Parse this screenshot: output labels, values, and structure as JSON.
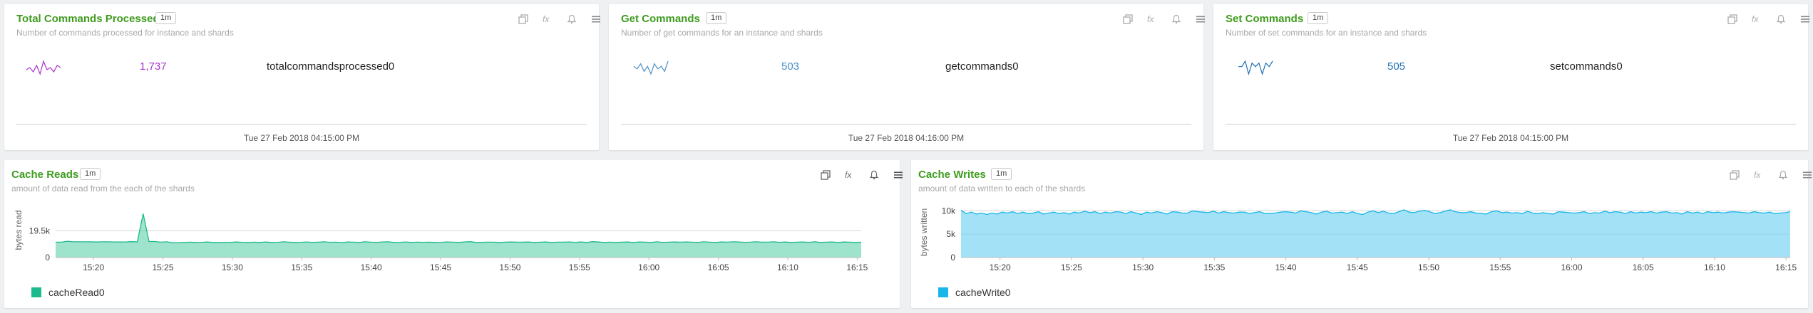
{
  "stats": [
    {
      "title": "Total Commands Processed",
      "interval": "1m",
      "subtitle": "Number of commands processed for instance and shards",
      "value": "1,737",
      "label": "totalcommandsprocessed0",
      "timestamp": "Tue 27 Feb 2018 04:15:00 PM",
      "color": "#a633cc",
      "spark": [
        5,
        6,
        4,
        7,
        3,
        9,
        5,
        6,
        4,
        7,
        6
      ]
    },
    {
      "title": "Get Commands",
      "interval": "1m",
      "subtitle": "Number of get commands for an instance and shards",
      "value": "503",
      "label": "getcommands0",
      "timestamp": "Tue 27 Feb 2018 04:16:00 PM",
      "color": "#4a8fc4",
      "spark": [
        6,
        5,
        7,
        4,
        6,
        3,
        7,
        5,
        6,
        4,
        8
      ]
    },
    {
      "title": "Set Commands",
      "interval": "1m",
      "subtitle": "Number of set commands for an instance and shards",
      "value": "505",
      "label": "setcommands0",
      "timestamp": "Tue 27 Feb 2018 04:15:00 PM",
      "color": "#1f6fb5",
      "spark": [
        6,
        6,
        9,
        2,
        8,
        6,
        8,
        2,
        8,
        6,
        9
      ]
    }
  ],
  "charts": [
    {
      "title": "Cache Reads",
      "interval": "1m",
      "subtitle": "amount of data read from the each of the shards",
      "legend": "cacheRead0",
      "color": "#1dba8e",
      "fill": "#9ee3cc",
      "chart_data": {
        "type": "area",
        "ylabel": "bytes read",
        "yticks": [
          0,
          19500
        ],
        "ytick_labels": [
          "0",
          "19.5k"
        ],
        "ylim": [
          0,
          40000
        ],
        "xticks": [
          "15:20",
          "15:25",
          "15:30",
          "15:35",
          "15:40",
          "15:45",
          "15:50",
          "15:55",
          "16:00",
          "16:05",
          "16:10",
          "16:15"
        ],
        "series": [
          {
            "name": "cacheRead0",
            "values": [
              11200,
              11200,
              11900,
              11500,
              11500,
              11500,
              11500,
              11300,
              11500,
              11500,
              11400,
              11300,
              11400,
              11600,
              11500,
              32000,
              11700,
              11700,
              11200,
              11500,
              10800,
              10800,
              11000,
              11200,
              11000,
              11100,
              11300,
              11000,
              11000,
              11000,
              11100,
              11300,
              11100,
              11000,
              11200,
              11000,
              11300,
              11000,
              11100,
              11500,
              11200,
              11000,
              11100,
              11400,
              11000,
              11200,
              11500,
              11100,
              11200,
              10900,
              11400,
              11200,
              11000,
              11500,
              11200,
              11100,
              11400,
              11500,
              11000,
              11100,
              11400,
              11000,
              11200,
              11100,
              11200,
              11000,
              11100,
              11400,
              11200,
              11000,
              11400,
              11600,
              11000,
              11100,
              11200,
              11200,
              11000,
              11200,
              11300,
              11200,
              11200,
              11300,
              11000,
              11200,
              11300,
              11000,
              11200,
              11200,
              11400,
              11100,
              11300,
              11000,
              11600,
              11300,
              11000,
              11200,
              11000,
              11200,
              11300,
              11000,
              11300,
              11200,
              11000,
              11500,
              11000,
              11200,
              11300,
              11200,
              11400,
              11200,
              11000,
              11500,
              11200,
              11000,
              11300,
              11200,
              11500,
              11300,
              11100,
              11200,
              11500,
              11200,
              11200,
              11500,
              11100,
              11300,
              11000,
              11200,
              11300,
              11100,
              11500,
              11000,
              11200,
              11300,
              11000,
              11300,
              11200,
              11000,
              11200
            ]
          }
        ]
      }
    },
    {
      "title": "Cache Writes",
      "interval": "1m",
      "subtitle": "amount of data written to each of the shards",
      "legend": "cacheWrite0",
      "color": "#19b6ea",
      "fill": "#a3e1f7",
      "chart_data": {
        "type": "area",
        "ylabel": "bytes written",
        "yticks": [
          0,
          5000,
          10000
        ],
        "ytick_labels": [
          "0",
          "5k",
          "10k"
        ],
        "ylim": [
          0,
          10800
        ],
        "xticks": [
          "15:20",
          "15:25",
          "15:30",
          "15:35",
          "15:40",
          "15:45",
          "15:50",
          "15:55",
          "16:00",
          "16:05",
          "16:10",
          "16:15"
        ],
        "series": [
          {
            "name": "cacheWrite0",
            "values": [
              10100,
              9400,
              9700,
              9300,
              9500,
              9200,
              9500,
              9300,
              9700,
              9500,
              9800,
              9400,
              9700,
              9400,
              9500,
              9800,
              9300,
              9500,
              9700,
              9400,
              9600,
              9300,
              9700,
              9500,
              9900,
              9600,
              9800,
              9400,
              9700,
              9500,
              9800,
              9700,
              9400,
              9800,
              9500,
              9200,
              9700,
              9500,
              9800,
              9600,
              9300,
              9800,
              9700,
              9500,
              9500,
              10000,
              9800,
              9700,
              9600,
              9900,
              9500,
              9800,
              9600,
              9500,
              9700,
              9700,
              9400,
              9600,
              9800,
              9400,
              9400,
              9500,
              9700,
              9800,
              9700,
              9500,
              10000,
              9800,
              9600,
              9300,
              9700,
              9900,
              9500,
              9600,
              9700,
              9400,
              9800,
              9400,
              9200,
              9700,
              10000,
              9600,
              9900,
              9500,
              9400,
              9800,
              10200,
              9700,
              9600,
              9900,
              10100,
              9800,
              9400,
              9600,
              9900,
              10200,
              9800,
              9600,
              9600,
              9800,
              9500,
              9400,
              9300,
              9800,
              10000,
              9600,
              9700,
              9500,
              9600,
              9400,
              9900,
              9500,
              9400,
              9600,
              9400,
              9300,
              9800,
              9700,
              9600,
              9500,
              9600,
              9800,
              9400,
              9600,
              9500,
              9900,
              9600,
              9800,
              9700,
              9400,
              9800,
              9500,
              9700,
              9600,
              9800,
              9500,
              9700,
              9800,
              9500,
              9600,
              9300,
              9800,
              9500,
              9700,
              9400,
              9800,
              9600,
              9700,
              9500,
              9700,
              9800,
              9700,
              9600,
              9500,
              9800,
              9600,
              9500,
              9700,
              9400,
              9500,
              9600,
              9800
            ]
          }
        ]
      }
    }
  ]
}
